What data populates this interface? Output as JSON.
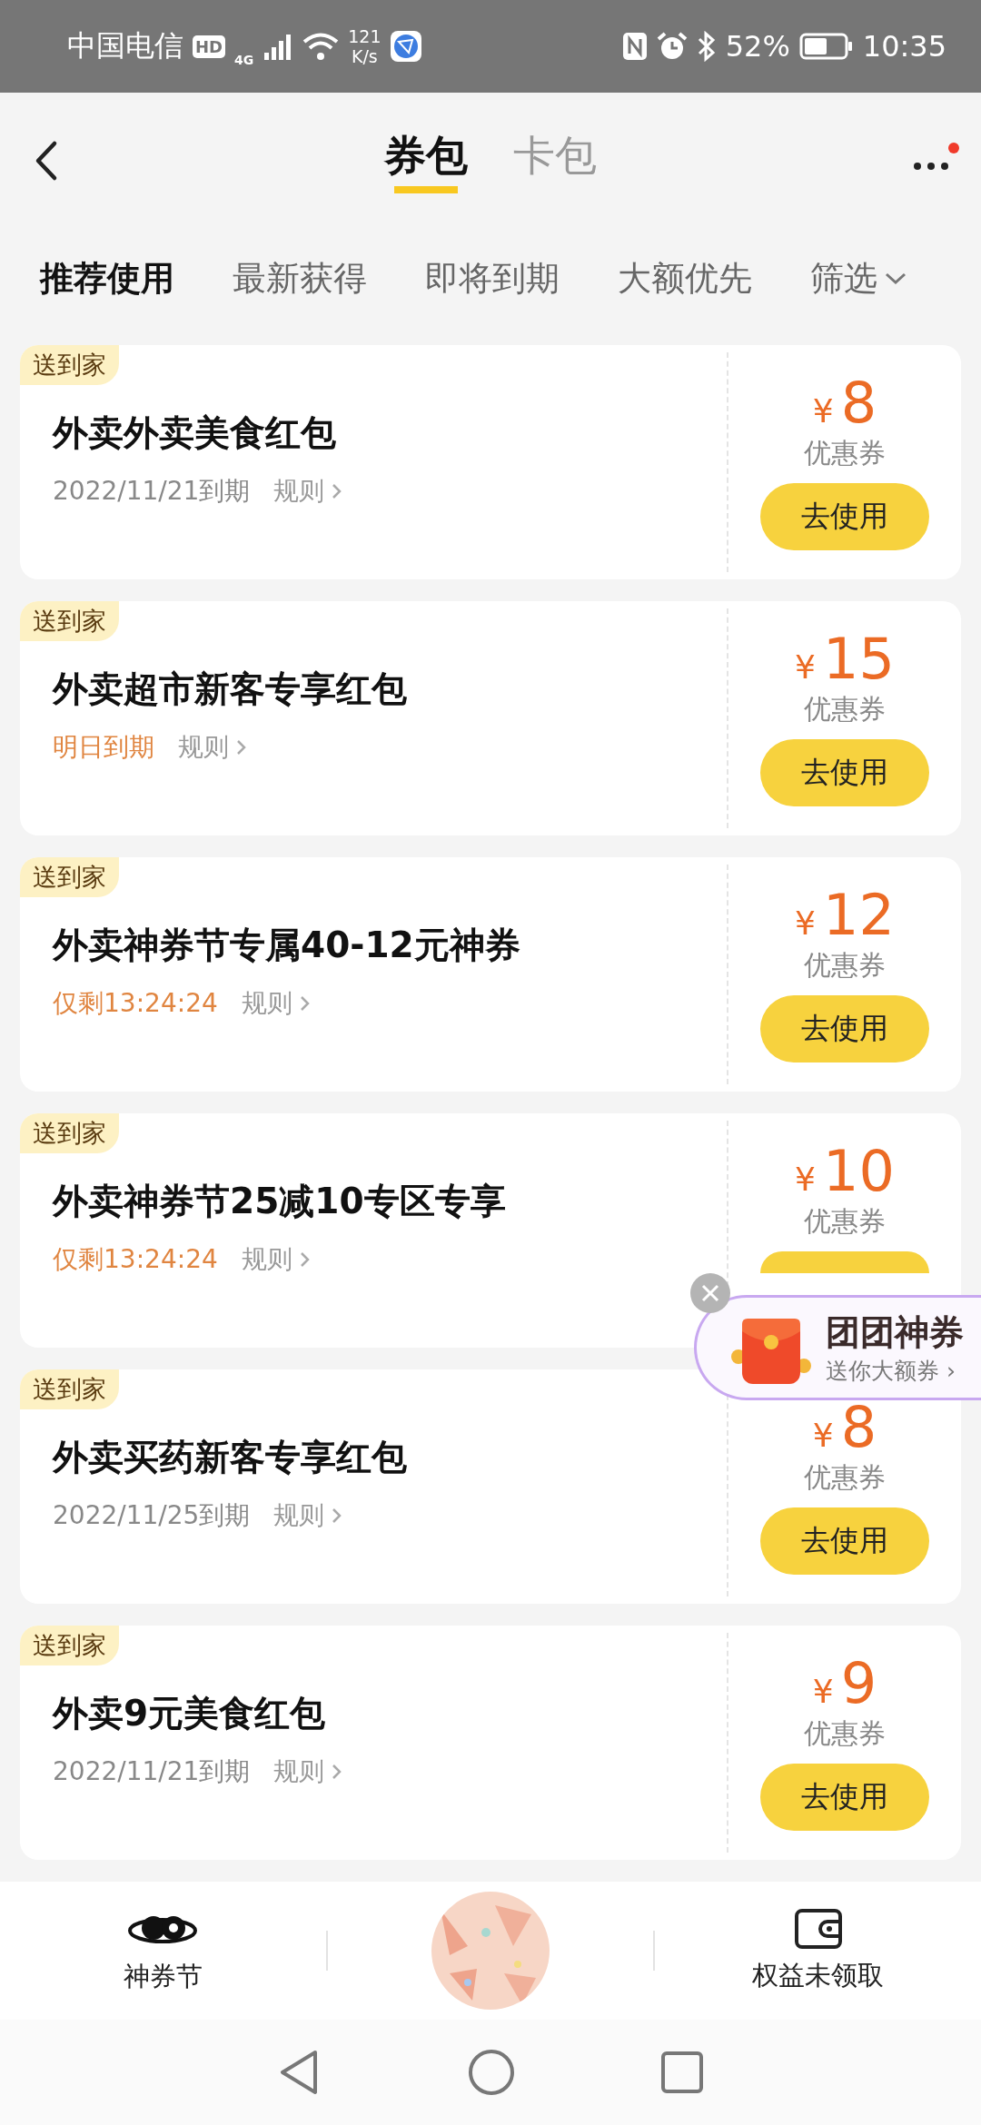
{
  "status_bar": {
    "carrier": "中国电信",
    "hd": "HD",
    "network": "4G",
    "speed_value": "121",
    "speed_unit": "K/s",
    "battery": "52%",
    "time": "10:35"
  },
  "header": {
    "tabs": [
      {
        "label": "券包",
        "selected": true
      },
      {
        "label": "卡包",
        "selected": false
      }
    ],
    "more_badge": true
  },
  "filters": [
    {
      "label": "推荐使用",
      "selected": true
    },
    {
      "label": "最新获得",
      "selected": false
    },
    {
      "label": "即将到期",
      "selected": false
    },
    {
      "label": "大额优先",
      "selected": false
    }
  ],
  "filter_button": "筛选",
  "coupons": [
    {
      "tag": "送到家",
      "title": "外卖外卖美食红包",
      "expiry": "2022/11/21到期",
      "urgent": false,
      "rules": "规则",
      "currency": "¥",
      "amount": "8",
      "type": "优惠券",
      "button": "去使用"
    },
    {
      "tag": "送到家",
      "title": "外卖超市新客专享红包",
      "expiry": "明日到期",
      "urgent": true,
      "rules": "规则",
      "currency": "¥",
      "amount": "15",
      "type": "优惠券",
      "button": "去使用"
    },
    {
      "tag": "送到家",
      "title": "外卖神券节专属40-12元神券",
      "expiry": "仅剩13:24:24",
      "urgent": true,
      "rules": "规则",
      "currency": "¥",
      "amount": "12",
      "type": "优惠券",
      "button": "去使用"
    },
    {
      "tag": "送到家",
      "title": "外卖神券节25减10专区专享",
      "expiry": "仅剩13:24:24",
      "urgent": true,
      "rules": "规则",
      "currency": "¥",
      "amount": "10",
      "type": "优惠券"
    },
    {
      "tag": "送到家",
      "title": "外卖买药新客专享红包",
      "expiry": "2022/11/25到期",
      "urgent": false,
      "rules": "规则",
      "currency": "¥",
      "amount": "8",
      "type": "优惠券",
      "button": "去使用"
    },
    {
      "tag": "送到家",
      "title": "外卖9元美食红包",
      "expiry": "2022/11/21到期",
      "urgent": false,
      "rules": "规则",
      "currency": "¥",
      "amount": "9",
      "type": "优惠券",
      "button": "去使用"
    }
  ],
  "float_promo": {
    "title": "团团神券",
    "subtitle": "送你大额券 ›"
  },
  "bottom_nav": [
    {
      "kind": "festival",
      "label": "神券节"
    },
    {
      "kind": "center"
    },
    {
      "kind": "wallet",
      "label": "权益未领取"
    }
  ]
}
